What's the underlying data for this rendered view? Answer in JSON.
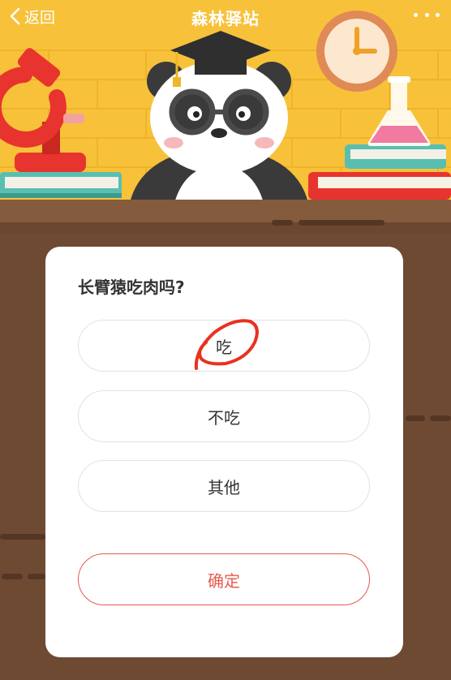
{
  "nav": {
    "back_label": "返回",
    "title": "森林驿站"
  },
  "quiz": {
    "question": "长臂猿吃肉吗?",
    "options": [
      "吃",
      "不吃",
      "其他"
    ],
    "confirm_label": "确定"
  },
  "colors": {
    "header_yellow": "#f7c23a",
    "desk_brown": "#6e4a33",
    "accent_red": "#e85a4f",
    "annotation_red": "#e8321f"
  }
}
